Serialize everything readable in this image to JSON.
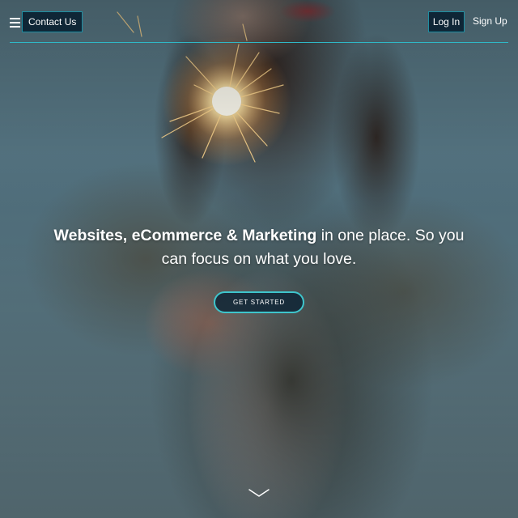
{
  "header": {
    "contact_label": "Contact Us",
    "login_label": "Log In",
    "signup_label": "Sign Up"
  },
  "hero": {
    "headline_bold": "Websites, eCommerce & Marketing",
    "headline_rest": " in one place. So you can focus on what you love.",
    "cta_label": "GET STARTED"
  },
  "icons": {
    "menu": "hamburger-icon",
    "scroll": "chevron-down-icon"
  },
  "colors": {
    "accent": "#2fb8c6",
    "button_bg": "#0f2636",
    "cta_border": "#3ec5cc"
  }
}
